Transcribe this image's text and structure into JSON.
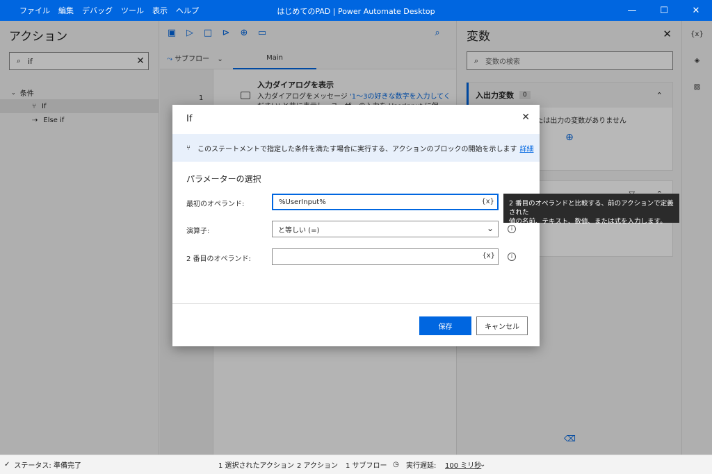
{
  "titlebar": {
    "menu": [
      "ファイル",
      "編集",
      "デバッグ",
      "ツール",
      "表示",
      "ヘルプ"
    ],
    "title": "はじめてのPAD | Power Automate Desktop",
    "minimize": "—",
    "maximize": "☐",
    "close": "✕"
  },
  "actions": {
    "title": "アクション",
    "search_value": "if",
    "group": "条件",
    "items": [
      "If",
      "Else if"
    ]
  },
  "toolbar": {
    "subflow_label": "サブフロー",
    "main_tab": "Main"
  },
  "flow": {
    "line_number": "1",
    "step_title": "入力ダイアログを表示",
    "step_desc_prefix": "入力ダイアログをメッセージ",
    "step_desc_quote": "'1～3の好きな数字を入力してく",
    "step_desc_rest": "ださい' と共に表示し、ユーザーの入力を UserInput に保"
  },
  "variables": {
    "title": "変数",
    "search_placeholder": "変数の検索",
    "io_header": "入出力変数",
    "io_count": "0",
    "io_empty": "に入力または出力の変数がありません"
  },
  "rail": [
    "{x}"
  ],
  "statusbar": {
    "status": "ステータス: 準備完了",
    "selected": "1 選択されたアクション",
    "actions": "2 アクション",
    "subflows": "1 サブフロー",
    "delay_label": "実行遅延:",
    "delay_value": "100 ミリ秒"
  },
  "dialog": {
    "title": "If",
    "info_text": "このステートメントで指定した条件を満たす場合に実行する、アクションのブロックの開始を示します",
    "info_link": "詳細",
    "section": "パラメーターの選択",
    "first_label": "最初のオペランド:",
    "first_value": "%UserInput%",
    "operator_label": "演算子:",
    "operator_value": "と等しい (=)",
    "second_label": "2 番目のオペランド:",
    "second_value": "",
    "var_token": "{x}",
    "save": "保存",
    "cancel": "キャンセル"
  },
  "tooltip": {
    "line1": "2 番目のオペランドと比較する、前のアクションで定義された",
    "line2": "値の名前、テキスト、数値、または式を入力します。"
  }
}
